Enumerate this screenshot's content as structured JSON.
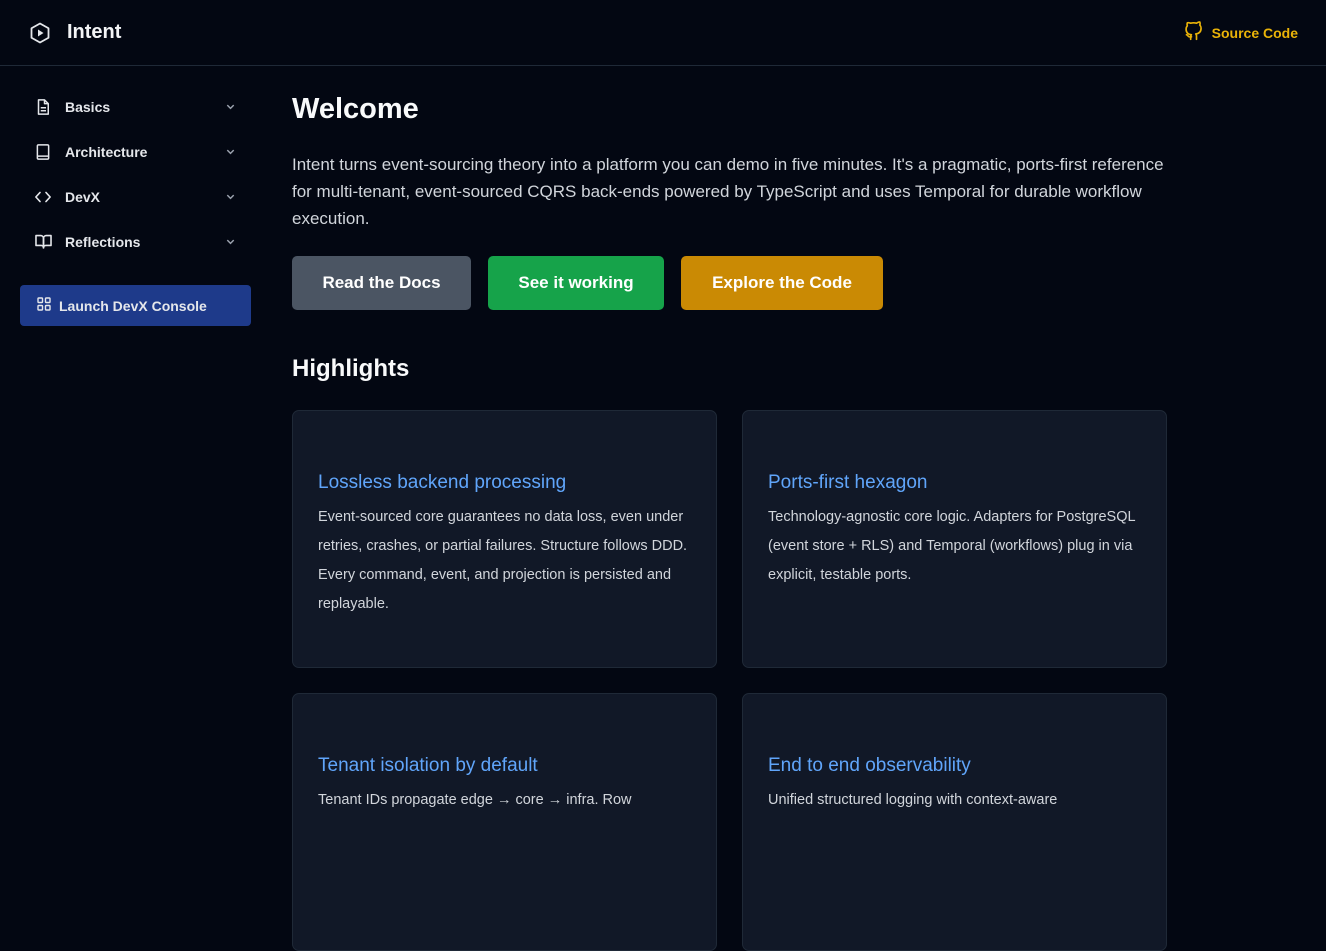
{
  "header": {
    "brand_title": "Intent",
    "source_link_label": "Source Code"
  },
  "sidebar": {
    "items": [
      {
        "label": "Basics",
        "icon": "document-icon"
      },
      {
        "label": "Architecture",
        "icon": "book-icon"
      },
      {
        "label": "DevX",
        "icon": "code-icon"
      },
      {
        "label": "Reflections",
        "icon": "open-book-icon"
      }
    ],
    "launch_button_label": "Launch DevX Console"
  },
  "main": {
    "title": "Welcome",
    "intro": "Intent turns event-sourcing theory into a platform you can demo in five minutes. It's a pragmatic, ports-first reference for multi-tenant, event-sourced CQRS back-ends powered by TypeScript and uses Temporal for durable workflow execution.",
    "buttons": {
      "docs": "Read the Docs",
      "working": "See it working",
      "code": "Explore the Code"
    },
    "highlights_title": "Highlights",
    "cards": [
      {
        "title": "Lossless backend processing",
        "text": "Event-sourced core guarantees no data loss, even under retries, crashes, or partial failures. Structure follows DDD. Every command, event, and projection is persisted and replayable."
      },
      {
        "title": "Ports-first hexagon",
        "text": "Technology-agnostic core logic. Adapters for PostgreSQL (event store + RLS) and Temporal (workflows) plug in via explicit, testable ports."
      },
      {
        "title": "Tenant isolation by default",
        "text": "Tenant IDs propagate edge → core → infra. Row"
      },
      {
        "title": "End to end observability",
        "text": "Unified structured logging with context-aware"
      }
    ]
  },
  "colors": {
    "background": "#030712",
    "accent_yellow": "#eab308",
    "launch_blue": "#1e3a8a",
    "btn_gray": "#4b5563",
    "btn_green": "#16a34a",
    "btn_gold": "#ca8a04",
    "card_title_blue": "#60a5fa"
  }
}
